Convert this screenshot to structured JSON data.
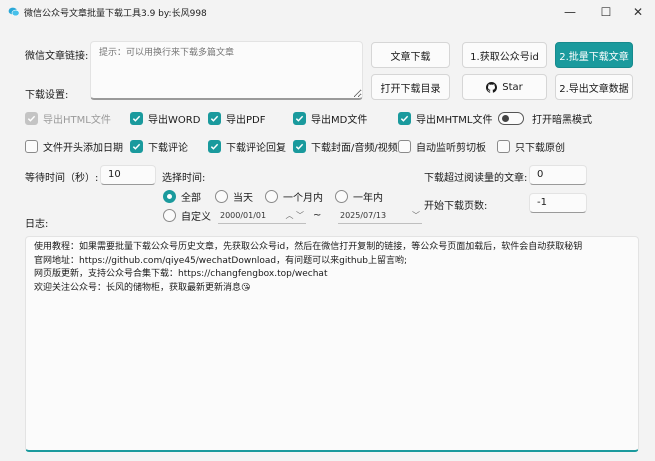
{
  "window": {
    "title": "微信公众号文章批量下载工具3.9 by:长风998",
    "minimize": "—",
    "maximize": "☐",
    "close": "✕"
  },
  "labels": {
    "url_label": "微信文章链接:",
    "download_settings": "下载设置:",
    "wait_time": "等待时间（秒）:",
    "select_time": "选择时间:",
    "read_threshold": "下载超过阅读量的文章:",
    "start_page": "开始下载页数:",
    "log": "日志:"
  },
  "url_input": {
    "placeholder": "提示：可以用换行来下载多篇文章",
    "value": ""
  },
  "buttons": {
    "article_download": "文章下载",
    "get_account_id": "1.获取公众号id",
    "batch_download": "2.批量下载文章",
    "open_dir": "打开下载目录",
    "star": "Star",
    "export_data": "2.导出文章数据"
  },
  "options": {
    "export_html": {
      "label": "导出HTML文件",
      "checked": true,
      "disabled": true
    },
    "export_word": {
      "label": "导出WORD",
      "checked": true
    },
    "export_pdf": {
      "label": "导出PDF",
      "checked": true
    },
    "export_md": {
      "label": "导出MD文件",
      "checked": true
    },
    "export_mhtml": {
      "label": "导出MHTML文件",
      "checked": true
    },
    "dark_mode": {
      "label": "打开暗黑模式",
      "on": false
    },
    "date_prefix": {
      "label": "文件开头添加日期",
      "checked": false
    },
    "download_comments": {
      "label": "下载评论",
      "checked": true
    },
    "comment_replies": {
      "label": "下载评论回复",
      "checked": true
    },
    "download_media": {
      "label": "下载封面/音频/视频",
      "checked": true
    },
    "clipboard_watch": {
      "label": "自动监听剪切板",
      "checked": false
    },
    "original_only": {
      "label": "只下载原创",
      "checked": false
    }
  },
  "wait_time_value": "10",
  "read_threshold_value": "0",
  "start_page_value": "-1",
  "time_range": {
    "all": "全部",
    "today": "当天",
    "month": "一个月内",
    "year": "一年内",
    "custom": "自定义",
    "selected": "all",
    "from": "2000/01/01",
    "to": "2025/07/13",
    "separator": "~"
  },
  "log_lines": [
    "使用教程：如果需要批量下载公众号历史文章，先获取公众号id，然后在微信打开复制的链接，等公众号页面加载后，软件会自动获取秘钥",
    "官网地址：https://github.com/qiye45/wechatDownload，有问题可以来github上留言哟;",
    "网页版更新，支持公众号合集下载：https://changfengbox.top/wechat",
    "欢迎关注公众号：长风的储物柜，获取最新更新消息😘"
  ],
  "colors": {
    "accent": "#1a9a9d"
  }
}
